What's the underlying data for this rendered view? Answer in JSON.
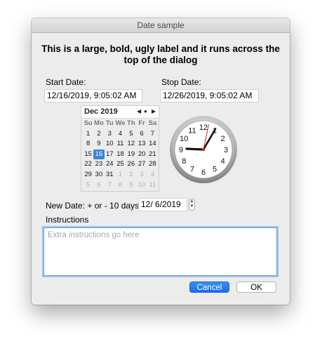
{
  "window": {
    "title": "Date sample"
  },
  "header": {
    "label": "This is a large, bold, ugly label and it runs across the top of the dialog"
  },
  "start_date": {
    "label": "Start Date:",
    "value": "12/16/2019,   9:05:02 AM"
  },
  "stop_date": {
    "label": "Stop Date:",
    "value": "12/26/2019,   9:05:02 AM"
  },
  "calendar": {
    "month_label": "Dec 2019",
    "nav": {
      "prev": "◀",
      "today": "●",
      "next": "▶"
    },
    "weekdays": [
      "Su",
      "Mo",
      "Tu",
      "We",
      "Th",
      "Fr",
      "Sa"
    ],
    "weeks": [
      [
        {
          "d": "1"
        },
        {
          "d": "2"
        },
        {
          "d": "3"
        },
        {
          "d": "4"
        },
        {
          "d": "5"
        },
        {
          "d": "6"
        },
        {
          "d": "7"
        }
      ],
      [
        {
          "d": "8"
        },
        {
          "d": "9"
        },
        {
          "d": "10"
        },
        {
          "d": "11"
        },
        {
          "d": "12"
        },
        {
          "d": "13"
        },
        {
          "d": "14"
        }
      ],
      [
        {
          "d": "15"
        },
        {
          "d": "16",
          "selected": true
        },
        {
          "d": "17"
        },
        {
          "d": "18"
        },
        {
          "d": "19"
        },
        {
          "d": "20"
        },
        {
          "d": "21"
        }
      ],
      [
        {
          "d": "22"
        },
        {
          "d": "23"
        },
        {
          "d": "24"
        },
        {
          "d": "25"
        },
        {
          "d": "26"
        },
        {
          "d": "27"
        },
        {
          "d": "28"
        }
      ],
      [
        {
          "d": "29"
        },
        {
          "d": "30"
        },
        {
          "d": "31"
        },
        {
          "d": "1",
          "other": true
        },
        {
          "d": "2",
          "other": true
        },
        {
          "d": "3",
          "other": true
        },
        {
          "d": "4",
          "other": true
        }
      ],
      [
        {
          "d": "5",
          "other": true
        },
        {
          "d": "6",
          "other": true
        },
        {
          "d": "7",
          "other": true
        },
        {
          "d": "8",
          "other": true
        },
        {
          "d": "9",
          "other": true
        },
        {
          "d": "10",
          "other": true
        },
        {
          "d": "11",
          "other": true
        }
      ]
    ]
  },
  "clock": {
    "numerals": [
      "12",
      "1",
      "2",
      "3",
      "4",
      "5",
      "6",
      "7",
      "8",
      "9",
      "10",
      "11"
    ],
    "time": {
      "hour": 9,
      "minute": 5,
      "second": 2
    },
    "second_hand_color": "#e02020"
  },
  "new_date": {
    "label": "New Date: + or - 10 days",
    "value": "12/  6/2019"
  },
  "instructions": {
    "label": "Instructions",
    "placeholder": "Extra instructions go here"
  },
  "buttons": {
    "cancel": "Cancel",
    "ok": "OK"
  },
  "colors": {
    "accent": "#1b6fe0",
    "selection": "#3b84d7"
  }
}
